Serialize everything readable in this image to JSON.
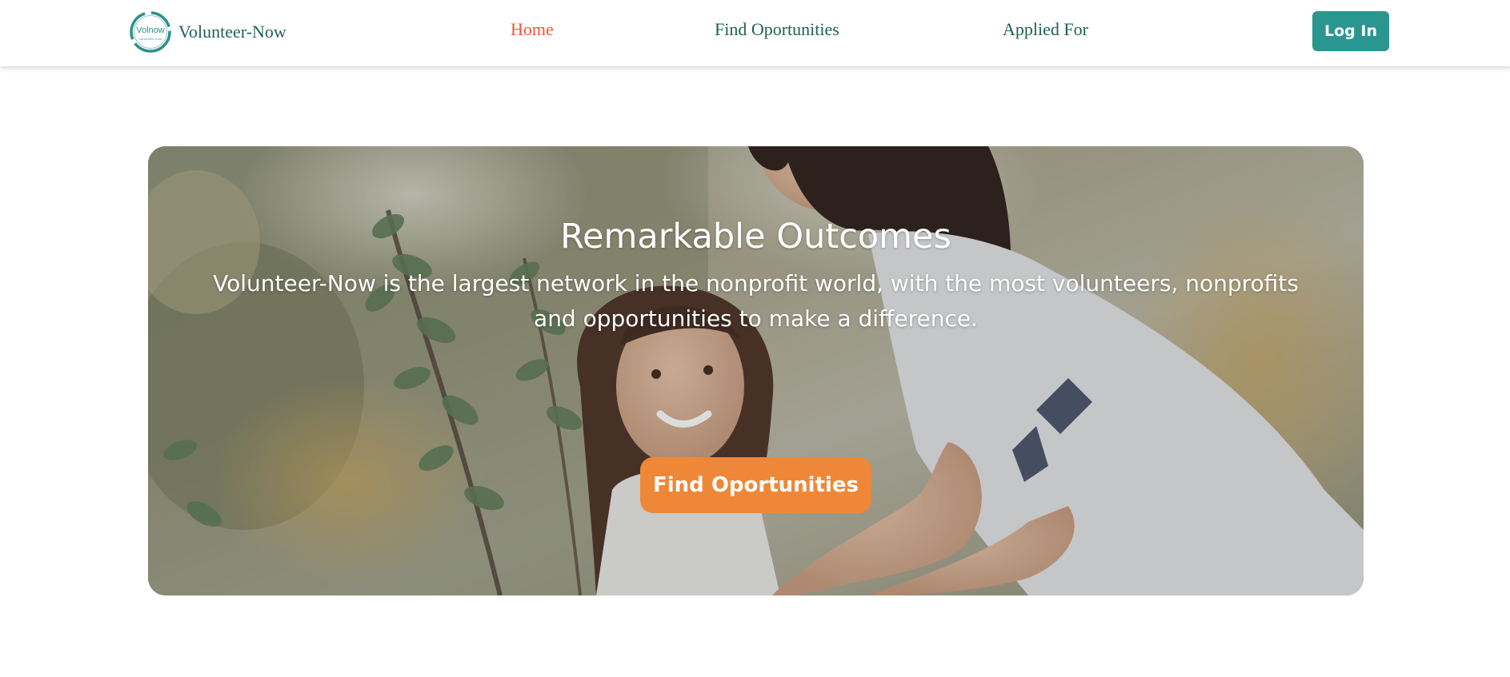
{
  "brand": {
    "logo_text": "Volnow",
    "logo_subtext": "volunteer now",
    "name": "Volunteer-Now"
  },
  "nav": {
    "items": [
      {
        "label": "Home",
        "active": true
      },
      {
        "label": "Find Oportunities",
        "active": false
      },
      {
        "label": "Applied For",
        "active": false
      }
    ],
    "login_label": "Log In"
  },
  "hero": {
    "title": "Remarkable Outcomes",
    "description": "Volunteer-Now is the largest network in the nonprofit world, with the most volunteers, nonprofits and opportunities to make a difference.",
    "cta_label": "Find Oportunities",
    "image_subject": "woman-and-girl-smiling-outdoors-photo"
  },
  "colors": {
    "accent": "#2a9690",
    "active_nav": "#f0582f",
    "nav_text": "#1f5f55",
    "cta": "#ee8838"
  }
}
